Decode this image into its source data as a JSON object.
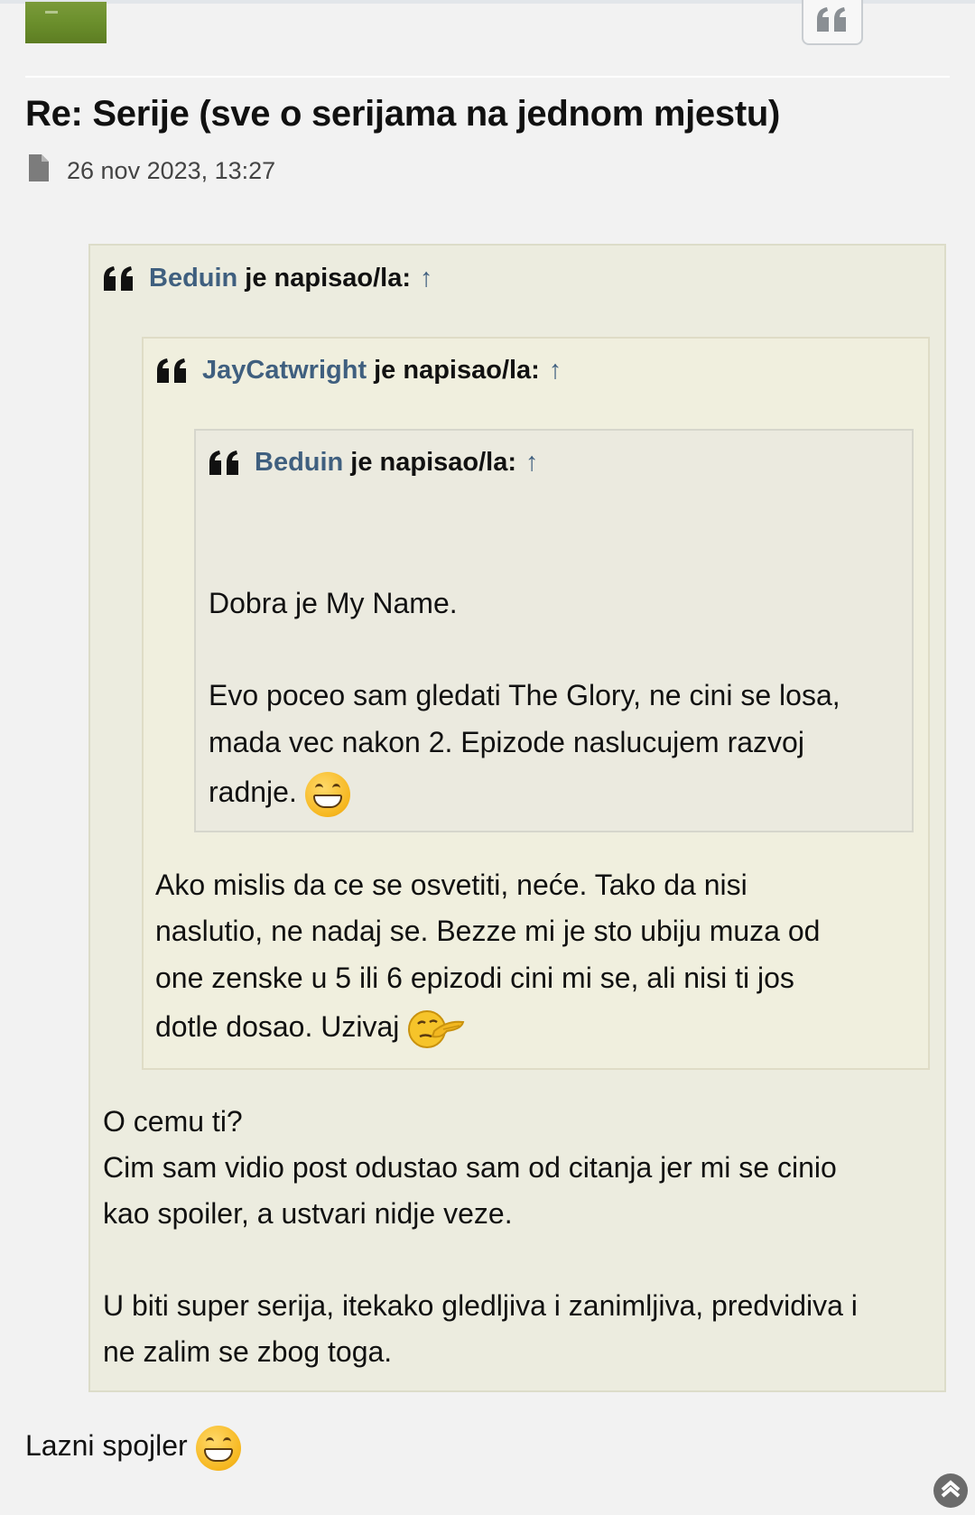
{
  "post": {
    "title": "Re: Serije (sve o serijama na jednom mjestu)",
    "date": "26 nov 2023, 13:27",
    "closing_text": "Lazni spojler"
  },
  "quote_level_1": {
    "author": "Beduin",
    "wrote": "je napisao/la:",
    "arrow": "↑",
    "line1": "O cemu ti?",
    "line2": "Cim sam vidio post odustao sam od citanja jer mi se cinio",
    "line3": "kao spoiler, a ustvari nidje veze.",
    "line4": "U biti super serija, itekako gledljiva i zanimljiva, predvidiva i",
    "line5": "ne zalim se zbog toga."
  },
  "quote_level_2": {
    "author": "JayCatwright",
    "wrote": "je napisao/la:",
    "arrow": "↑",
    "line1": "Ako mislis da ce se osvetiti, neće. Tako da nisi",
    "line2": "naslutio, ne nadaj se. Bezze mi je sto ubiju muza od",
    "line3": "one zenske u 5 ili 6 epizodi cini mi se, ali nisi ti jos",
    "line4": "dotle dosao. Uzivaj"
  },
  "quote_level_3": {
    "author": "Beduin",
    "wrote": "je napisao/la:",
    "arrow": "↑",
    "line1": "Dobra je My Name.",
    "line2": "Evo poceo sam gledati The Glory, ne cini se losa,",
    "line3": "mada vec nakon 2. Epizode naslucujem razvoj",
    "line4": "radnje."
  },
  "icons": {
    "quote_button": "quote-icon",
    "post_meta": "file-icon",
    "scroll_top": "chevron-up-circle-icon",
    "emoji_grin": "grinning-emoji-icon",
    "emoji_think": "thinking-emoji-icon"
  },
  "colors": {
    "author_link": "#3f5f7f",
    "quote_bg": "#ececdf",
    "page_bg": "#f2f2f2"
  }
}
